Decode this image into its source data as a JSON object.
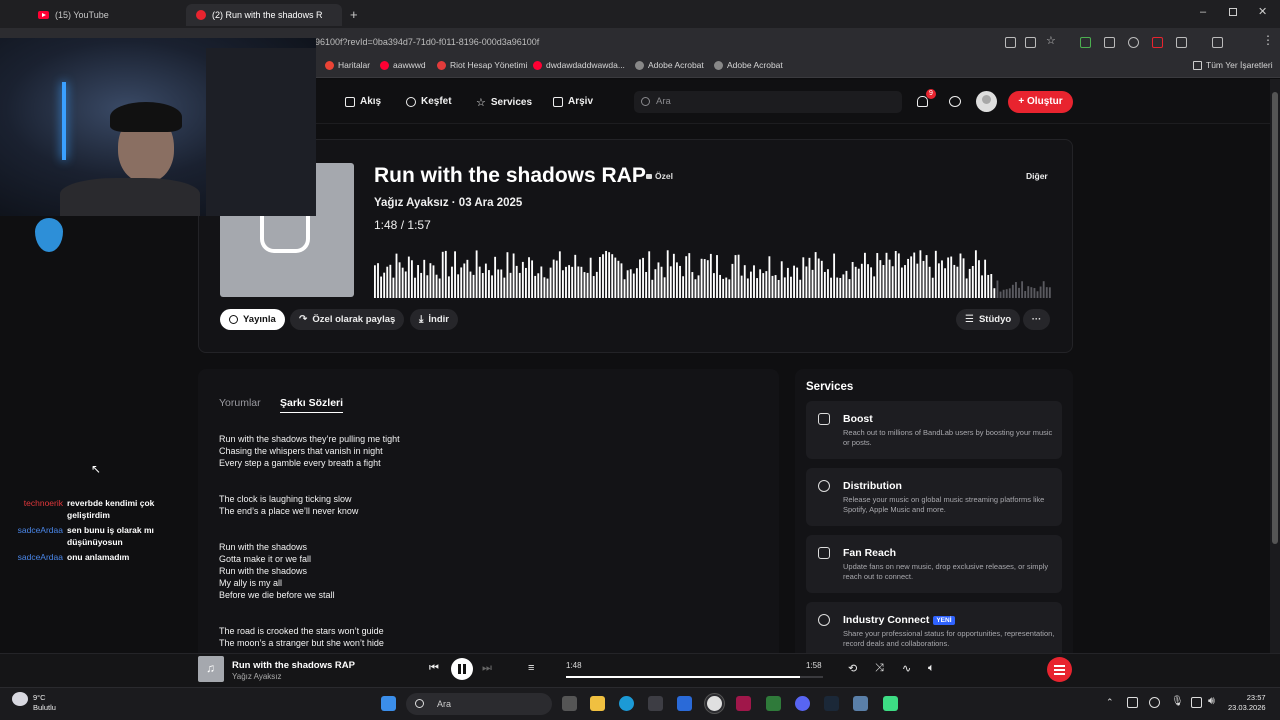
{
  "browser": {
    "tabs": [
      {
        "label": "(15) YouTube",
        "active": false
      },
      {
        "label": "(2) Run with the shadows R",
        "active": true
      }
    ],
    "url": "d3a96100f?revId=0ba394d7-71d0-f011-8196-000d3a96100f",
    "bookmarks": [
      "Haritalar",
      "aawwwd",
      "Riot Hesap Yönetimi",
      "dwdawdaddwawda...",
      "Adobe Acrobat",
      "Adobe Acrobat"
    ],
    "bookmarks_right": "Tüm Yer İşaretleri"
  },
  "nav": {
    "items": [
      "Akış",
      "Keşfet",
      "Services",
      "Arşiv"
    ],
    "search_placeholder": "Ara",
    "notification_count": "9",
    "create_label": "Oluştur"
  },
  "track": {
    "title": "Run with the shadows RAP",
    "privacy": "Özel",
    "artist_date": "Yağız Ayaksız · 03 Ara 2025",
    "current": "1:48",
    "separator": "/",
    "duration": "1:57",
    "progress_fraction": 0.92,
    "more_label": "Diğer",
    "buttons": {
      "publish": "Yayınla",
      "share": "Özel olarak paylaş",
      "download": "İndir",
      "studio": "Stüdyo",
      "ellipsis": "···"
    }
  },
  "lyrics_panel": {
    "tabs": [
      "Yorumlar",
      "Şarkı Sözleri"
    ],
    "active_tab": "Şarkı Sözleri",
    "lyrics": "Run with the shadows they’re pulling me tight\nChasing the whispers that vanish in night\nEvery step a gamble every breath a fight\n\n\nThe clock is laughing ticking slow\nThe end’s a place we’ll never know\n\n\nRun with the shadows\nGotta make it or we fall\nRun with the shadows\nMy ally is my all\nBefore we die before we stall\n\n\nThe road is crooked the stars won’t guide\nThe moon’s a stranger but she won’t hide"
  },
  "services": {
    "title": "Services",
    "items": [
      {
        "name": "Boost",
        "icon": "bolt-icon",
        "desc": "Reach out to millions of BandLab users by boosting your music or posts."
      },
      {
        "name": "Distribution",
        "icon": "globe-icon",
        "desc": "Release your music on global music streaming platforms like Spotify, Apple Music and more."
      },
      {
        "name": "Fan Reach",
        "icon": "mail-icon",
        "desc": "Update fans on new music, drop exclusive releases, or simply reach out to connect."
      },
      {
        "name": "Industry Connect",
        "icon": "people-icon",
        "badge": "YENİ",
        "desc": "Share your professional status for opportunities, representation, record deals and collaborations."
      }
    ]
  },
  "player": {
    "title": "Run with the shadows RAP",
    "artist": "Yağız Ayaksız",
    "current": "1:48",
    "duration": "1:58",
    "progress_fraction": 0.91
  },
  "chat": [
    {
      "user": "technoerik",
      "color": "#e0373b",
      "text": "reverbde kendimi çok geliştirdim"
    },
    {
      "user": "sadceArdaa",
      "color": "#4a86e8",
      "text": "sen bunu iş olarak mı düşünüyosun"
    },
    {
      "user": "sadceArdaa",
      "color": "#4a86e8",
      "text": "onu anlamadım"
    }
  ],
  "taskbar": {
    "search_placeholder": "Ara",
    "weather_temp": "9°C",
    "weather_desc": "Bulutlu",
    "time": "23:57",
    "date": "23.03.2026"
  },
  "colors": {
    "accent": "#e8242f",
    "background": "#0f0f11",
    "panel": "#131316"
  }
}
